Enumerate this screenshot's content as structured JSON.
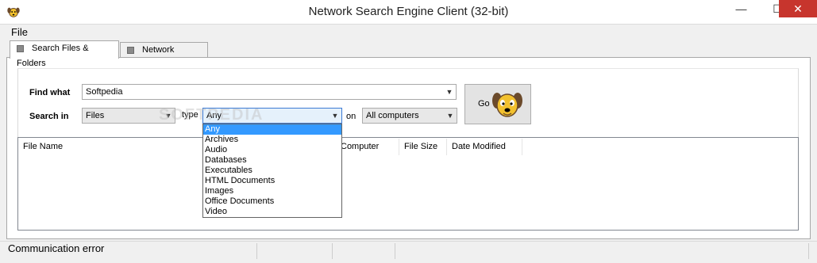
{
  "window": {
    "title": "Network Search Engine Client (32-bit)",
    "minimize_glyph": "—",
    "maximize_glyph": "☐",
    "close_glyph": "✕"
  },
  "menu": {
    "file_label": "File"
  },
  "tabs": [
    {
      "label": "Search Files & Folders",
      "active": true
    },
    {
      "label": "Network Browser",
      "active": false
    }
  ],
  "search": {
    "find_what_label": "Find what",
    "find_what_value": "Softpedia",
    "search_in_label": "Search in",
    "search_in_value": "Files",
    "type_label": "type",
    "type_value": "Any",
    "on_label": "on",
    "on_value": "All computers",
    "go_label": "Go"
  },
  "type_options": [
    "Any",
    "Archives",
    "Audio",
    "Databases",
    "Executables",
    "HTML Documents",
    "Images",
    "Office Documents",
    "Video"
  ],
  "results": {
    "columns": [
      "File Name",
      "Computer",
      "File Size",
      "Date Modified"
    ],
    "rows": []
  },
  "status": {
    "text": "Communication error"
  },
  "watermark": "SOFTPEDIA",
  "colors": {
    "selection": "#3399ff",
    "close_button": "#c7352d",
    "dog_fur": "#f2c12e",
    "dog_ears": "#6b4a2b"
  },
  "icons": {
    "app": "dog-icon",
    "go": "dog-icon",
    "dropdown": "chevron-down-icon"
  }
}
